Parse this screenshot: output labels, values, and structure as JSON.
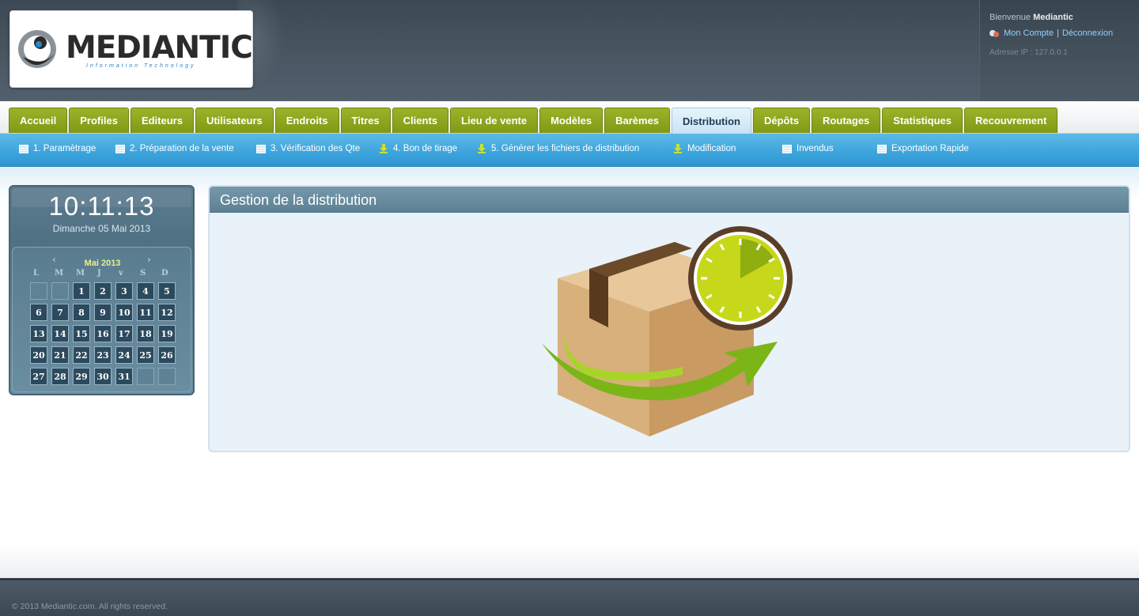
{
  "logo": {
    "name": "MEDIANTIC",
    "tagline": "Information Technology"
  },
  "user": {
    "welcome_prefix": "Bienvenue",
    "username": "Mediantic",
    "account_link": "Mon Compte",
    "separator": "|",
    "logout_link": "Déconnexion",
    "ip": "Adresse IP : 127.0.0.1"
  },
  "tabs": [
    {
      "label": "Accueil"
    },
    {
      "label": "Profiles"
    },
    {
      "label": "Editeurs"
    },
    {
      "label": "Utilisateurs"
    },
    {
      "label": "Endroits"
    },
    {
      "label": "Titres"
    },
    {
      "label": "Clients"
    },
    {
      "label": "Lieu de vente"
    },
    {
      "label": "Modèles"
    },
    {
      "label": "Barèmes"
    },
    {
      "label": "Distribution",
      "active": true
    },
    {
      "label": "Dépôts"
    },
    {
      "label": "Routages"
    },
    {
      "label": "Statistiques"
    },
    {
      "label": "Recouvrement"
    }
  ],
  "subnav": [
    {
      "label": "1. Paramètrage",
      "icon": "grid-icon"
    },
    {
      "label": "2. Préparation de la vente",
      "icon": "grid-icon"
    },
    {
      "label": "3. Vérification des Qte",
      "icon": "grid-icon"
    },
    {
      "label": "4. Bon de tirage",
      "icon": "download-icon"
    },
    {
      "label": "5. Générer les fichiers de distribution",
      "icon": "download-icon"
    },
    {
      "label": "Modification",
      "icon": "download-icon"
    },
    {
      "label": "Invendus",
      "icon": "grid-icon"
    },
    {
      "label": "Exportation Rapide",
      "icon": "grid-icon"
    }
  ],
  "clock": {
    "time": "10:11:13",
    "date": "Dimanche 05 Mai 2013"
  },
  "calendar": {
    "month": "Mai 2013",
    "prev": "‹",
    "next": "›",
    "weekdays": [
      "L",
      "M",
      "M",
      "J",
      "v",
      "S",
      "D"
    ],
    "weeks": [
      [
        "",
        "",
        "1",
        "2",
        "3",
        "4",
        "5"
      ],
      [
        "6",
        "7",
        "8",
        "9",
        "10",
        "11",
        "12"
      ],
      [
        "13",
        "14",
        "15",
        "16",
        "17",
        "18",
        "19"
      ],
      [
        "20",
        "21",
        "22",
        "23",
        "24",
        "25",
        "26"
      ],
      [
        "27",
        "28",
        "29",
        "30",
        "31",
        "",
        ""
      ]
    ]
  },
  "panel": {
    "title": "Gestion de la distribution"
  },
  "footer": {
    "copyright": "© 2013 Mediantic.com. All rights reserved."
  },
  "colors": {
    "tab_green": "#8aa61f",
    "subnav_blue": "#3ca4dc",
    "header_dark": "#3c4954"
  }
}
